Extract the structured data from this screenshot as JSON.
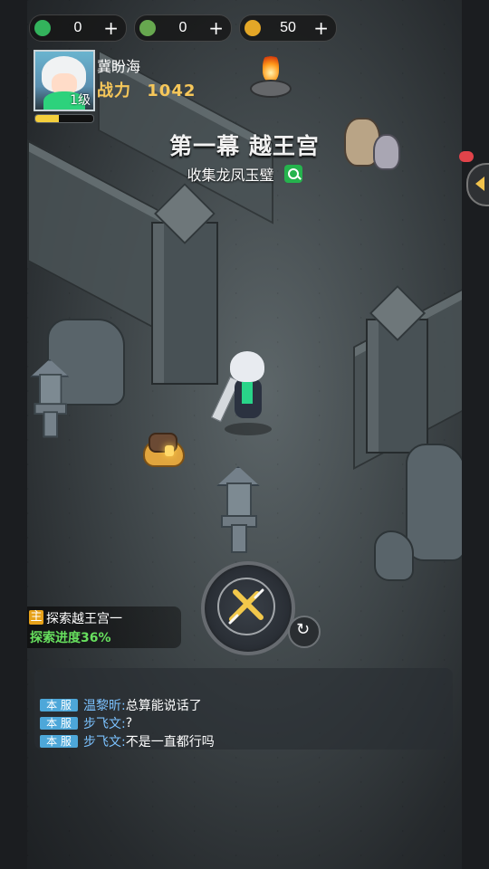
{
  "top_bar": {
    "currencies": [
      {
        "icon": "green-gem-icon",
        "value": "0",
        "plus": "+",
        "color": "#33b35c"
      },
      {
        "icon": "green-bag-icon",
        "value": "0",
        "plus": "+",
        "color": "#67a84f"
      },
      {
        "icon": "gold-coin-icon",
        "value": "50",
        "plus": "+",
        "color": "#e4a727"
      }
    ]
  },
  "player": {
    "name": "冀盼海",
    "level": "1级",
    "power_label": "战力",
    "power_value": "1042",
    "exp_fraction": 0.4
  },
  "stage": {
    "title": "第一幕 越王宫",
    "subtitle": "收集龙凤玉璧"
  },
  "quest": {
    "tag": "主",
    "name": "探索越王宫一",
    "progress": "探索进度36%"
  },
  "chat": {
    "messages": [
      {
        "channel": "本 服",
        "sender": "温黎昕:",
        "text": "总算能说话了"
      },
      {
        "channel": "本 服",
        "sender": "步飞文:",
        "text": "?"
      },
      {
        "channel": "本 服",
        "sender": "步飞文:",
        "text": "不是一直都行吗"
      }
    ]
  },
  "colors": {
    "accent_gold": "#f6c75a",
    "accent_green": "#67e05e",
    "chat_channel": "#4da7d9"
  }
}
